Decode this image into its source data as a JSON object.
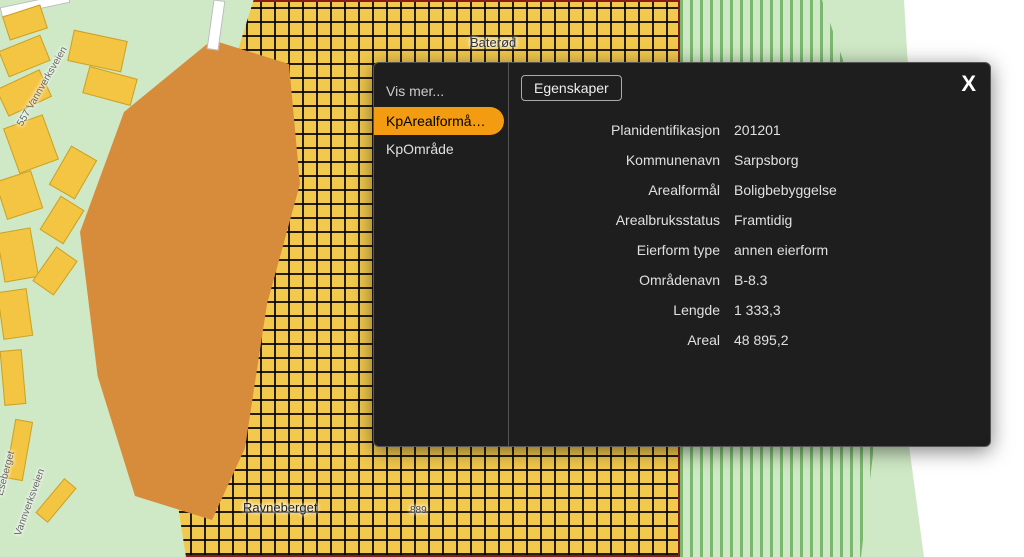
{
  "map": {
    "labels": {
      "baterod": "Baterød",
      "ravneberget": "Ravneberget",
      "road_vannverksveien": "557 Vannverksveien",
      "road_eseberget": "Eseberget",
      "road_vannverksveien2": "Vannverksveien",
      "num_889": "889"
    }
  },
  "popup": {
    "show_more": "Vis mer...",
    "sidebar": {
      "items": [
        {
          "label": "KpArealformå…",
          "active": true
        },
        {
          "label": "KpOmråde",
          "active": false
        }
      ]
    },
    "tab_label": "Egenskaper",
    "close_label": "X",
    "properties": [
      {
        "label": "Planidentifikasjon",
        "value": "201201"
      },
      {
        "label": "Kommunenavn",
        "value": "Sarpsborg"
      },
      {
        "label": "Arealformål",
        "value": "Boligbebyggelse"
      },
      {
        "label": "Arealbruksstatus",
        "value": "Framtidig"
      },
      {
        "label": "Eierform type",
        "value": "annen eierform"
      },
      {
        "label": "Områdenavn",
        "value": "B-8.3"
      },
      {
        "label": "Lengde",
        "value": "1 333,3"
      },
      {
        "label": "Areal",
        "value": "48 895,2"
      }
    ]
  }
}
